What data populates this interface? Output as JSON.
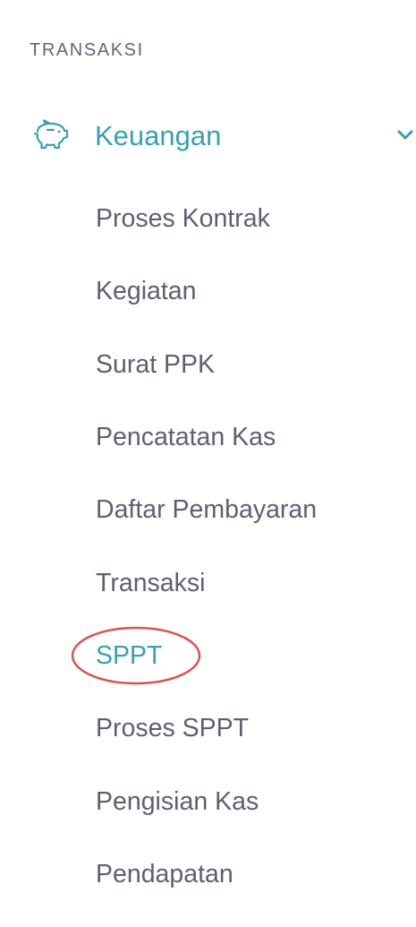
{
  "sidebar": {
    "section_title": "TRANSAKSI",
    "parent": {
      "label": "Keuangan",
      "icon": "piggy-bank-icon",
      "expand_icon": "chevron-down-icon",
      "accent_color": "#3a9fb1"
    },
    "items": [
      {
        "label": "Proses Kontrak"
      },
      {
        "label": "Kegiatan"
      },
      {
        "label": "Surat PPK"
      },
      {
        "label": "Pencatatan Kas"
      },
      {
        "label": "Daftar Pembayaran"
      },
      {
        "label": "Transaksi"
      },
      {
        "label": "SPPT",
        "active": true
      },
      {
        "label": "Proses SPPT"
      },
      {
        "label": "Pengisian Kas"
      },
      {
        "label": "Pendapatan"
      }
    ],
    "annotation_color": "#d9534f"
  }
}
